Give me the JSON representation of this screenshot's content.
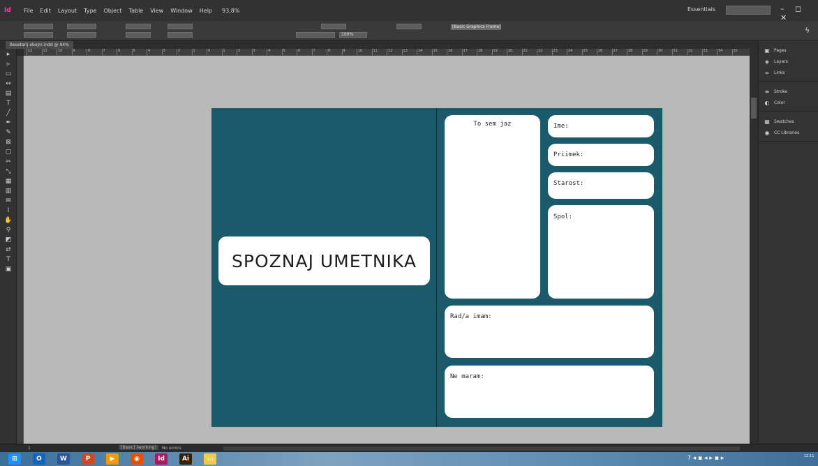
{
  "menubar": {
    "app_logo": "Id",
    "items": [
      "File",
      "Edit",
      "Layout",
      "Type",
      "Object",
      "Table",
      "View",
      "Window",
      "Help"
    ],
    "zoom": "93,8%",
    "workspace": "Essentials",
    "window_controls": "– ◻ ✕"
  },
  "controlbar": {
    "paragraph_style": "[Basic Graphics Frame]",
    "stroke_percent": "100%"
  },
  "document_tab": {
    "label": "Besetarij obojni.indd @ 94%"
  },
  "rulers": {
    "h_ticks": [
      "12",
      "11",
      "10",
      "9",
      "8",
      "7",
      "6",
      "5",
      "4",
      "3",
      "2",
      "1",
      "0",
      "1",
      "2",
      "3",
      "4",
      "5",
      "6",
      "7",
      "8",
      "9",
      "10",
      "11",
      "12",
      "13",
      "14",
      "15",
      "16",
      "17",
      "18",
      "19",
      "20",
      "21",
      "22",
      "23",
      "24",
      "25",
      "26",
      "27",
      "28",
      "29",
      "30",
      "31",
      "32",
      "33",
      "34",
      "35"
    ]
  },
  "tools": {
    "icons": [
      "selection-icon",
      "direct-selection-icon",
      "page-icon",
      "gap-icon",
      "content-collector-icon",
      "type-icon",
      "line-icon",
      "pen-icon",
      "pencil-icon",
      "rectangle-frame-icon",
      "rectangle-icon",
      "scissors-icon",
      "free-transform-icon",
      "gradient-swatch-icon",
      "gradient-feather-icon",
      "note-icon",
      "eyedropper-icon",
      "hand-icon",
      "zoom-icon",
      "fill-stroke-icon",
      "swap-icon",
      "formatting-icon",
      "view-mode-icon"
    ]
  },
  "page": {
    "background_color": "#1b5a6b",
    "title": "SPOZNAJ UMETNIKA",
    "cards": {
      "to_sem_jaz": "To sem jaz",
      "ime": "Ime:",
      "priimek": "Priimek:",
      "starost": "Starost:",
      "spol": "Spol:",
      "rad_imam": "Rad/a imam:",
      "ne_maram": "Ne maram:"
    }
  },
  "panels": {
    "group1": [
      {
        "icon": "pages-icon",
        "label": "Pages"
      },
      {
        "icon": "layers-icon",
        "label": "Layers"
      },
      {
        "icon": "links-icon",
        "label": "Links"
      }
    ],
    "group2": [
      {
        "icon": "stroke-icon",
        "label": "Stroke"
      },
      {
        "icon": "color-icon",
        "label": "Color"
      }
    ],
    "group3": [
      {
        "icon": "swatches-icon",
        "label": "Swatches"
      },
      {
        "icon": "cc-libraries-icon",
        "label": "CC Libraries"
      }
    ]
  },
  "statusbar": {
    "page_number": "1",
    "style": "[Basic] (working)",
    "preflight": "No errors"
  },
  "taskbar": {
    "apps": [
      {
        "name": "windows-start",
        "label": "⊞",
        "color": "#1e90ff"
      },
      {
        "name": "outlook",
        "label": "O",
        "color": "#1565c0"
      },
      {
        "name": "word",
        "label": "W",
        "color": "#2b579a"
      },
      {
        "name": "powerpoint",
        "label": "P",
        "color": "#d24726"
      },
      {
        "name": "media-player",
        "label": "▶",
        "color": "#ff9800"
      },
      {
        "name": "firefox",
        "label": "◉",
        "color": "#e65100"
      },
      {
        "name": "indesign",
        "label": "Id",
        "color": "#b0175f"
      },
      {
        "name": "illustrator",
        "label": "Ai",
        "color": "#3a2200"
      },
      {
        "name": "file-explorer",
        "label": "▭",
        "color": "#f2c94c"
      }
    ],
    "clock": "12:11"
  }
}
